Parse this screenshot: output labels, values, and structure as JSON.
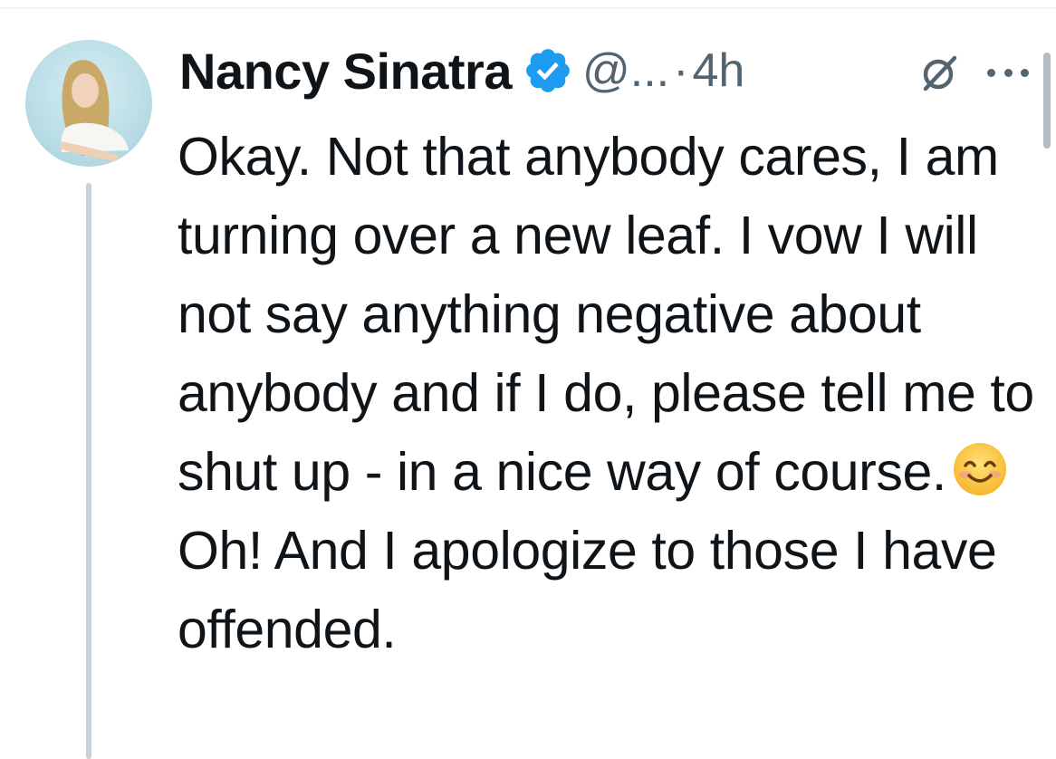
{
  "tweet": {
    "author": {
      "display_name": "Nancy Sinatra",
      "handle": "@...",
      "verified": true,
      "avatar_icon": "profile-photo"
    },
    "separator": "·",
    "timestamp": "4h",
    "icons": {
      "verified": "verified-badge-icon",
      "grok": "grok-icon",
      "more": "more-options-icon"
    },
    "text": {
      "part1": "Okay. Not that anybody cares,  I am turning over a new leaf. I vow I will not say anything negative about anybody and if I do, please tell me to shut up - in a nice way of course.",
      "emoji": "😊",
      "part2": "Oh! And I apologize to those I have offended."
    },
    "colors": {
      "verified_blue": "#1d9bf0",
      "secondary_text": "#536471",
      "primary_text": "#0f1419"
    }
  }
}
